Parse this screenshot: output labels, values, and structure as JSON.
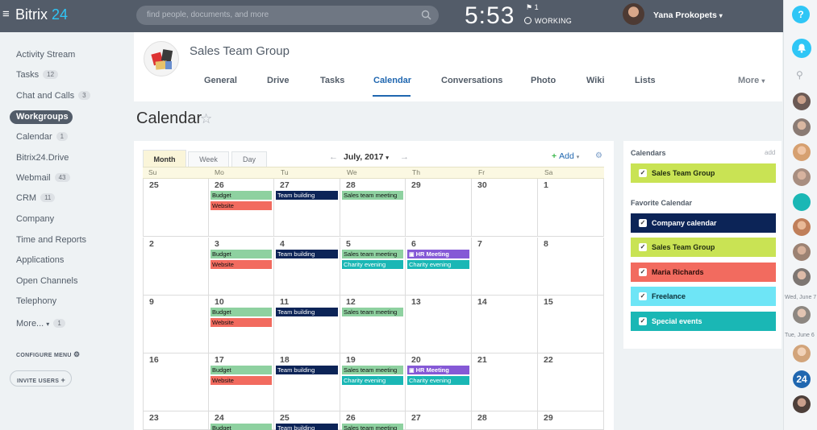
{
  "app": {
    "logo_name": "Bitrix",
    "logo_num": "24"
  },
  "search": {
    "placeholder": "find people, documents, and more"
  },
  "clock": {
    "time": "5:53",
    "flag_count": "1",
    "status": "WORKING"
  },
  "user": {
    "name": "Yana Prokopets"
  },
  "sidebar": {
    "items": [
      {
        "label": "Activity Stream",
        "badge": ""
      },
      {
        "label": "Tasks",
        "badge": "12"
      },
      {
        "label": "Chat and Calls",
        "badge": "3"
      },
      {
        "label": "Workgroups",
        "badge": ""
      },
      {
        "label": "Calendar",
        "badge": "1"
      },
      {
        "label": "Bitrix24.Drive",
        "badge": ""
      },
      {
        "label": "Webmail",
        "badge": "43"
      },
      {
        "label": "CRM",
        "badge": "11"
      },
      {
        "label": "Company",
        "badge": ""
      },
      {
        "label": "Time and Reports",
        "badge": ""
      },
      {
        "label": "Applications",
        "badge": ""
      },
      {
        "label": "Open Channels",
        "badge": ""
      },
      {
        "label": "Telephony",
        "badge": ""
      },
      {
        "label": "More...",
        "badge": "1"
      }
    ],
    "configure": "CONFIGURE MENU",
    "invite": "INVITE USERS"
  },
  "group": {
    "title": "Sales Team Group",
    "tabs": [
      "General",
      "Drive",
      "Tasks",
      "Calendar",
      "Conversations",
      "Photo",
      "Wiki",
      "Lists",
      "More"
    ]
  },
  "page": {
    "title": "Calendar"
  },
  "calendar": {
    "views": [
      "Month",
      "Week",
      "Day"
    ],
    "month": "July, 2017",
    "add_label": "Add",
    "weekdays": [
      "Su",
      "Mo",
      "Tu",
      "We",
      "Th",
      "Fr",
      "Sa"
    ],
    "weeks": [
      [
        "25",
        "26",
        "27",
        "28",
        "29",
        "30",
        "1"
      ],
      [
        "2",
        "3",
        "4",
        "5",
        "6",
        "7",
        "8"
      ],
      [
        "9",
        "10",
        "11",
        "12",
        "13",
        "14",
        "15"
      ],
      [
        "16",
        "17",
        "18",
        "19",
        "20",
        "21",
        "22"
      ],
      [
        "23",
        "24",
        "25",
        "26",
        "27",
        "28",
        "29"
      ]
    ],
    "events": {
      "budget": "Budget",
      "website": "Website",
      "team": "Team building",
      "sales": "Sales team meeting",
      "charity": "Charity evening",
      "hr": "HR Meeting"
    }
  },
  "side": {
    "calendars_title": "Calendars",
    "add": "add",
    "favorite_title": "Favorite Calendar",
    "calendars": [
      "Sales Team Group"
    ],
    "favorites": [
      "Company calendar",
      "Sales Team Group",
      "Maria Richards",
      "Freelance",
      "Special events"
    ]
  },
  "rail": {
    "day1": "Wed, June 7",
    "day2": "Tue, June 6",
    "b24": "24"
  },
  "colors": {
    "green": "#8ed1a0",
    "red": "#f26b5f",
    "navy": "#0c2457",
    "teal": "#1ab7b5",
    "purple": "#8559d6",
    "lime": "#c9e354"
  }
}
